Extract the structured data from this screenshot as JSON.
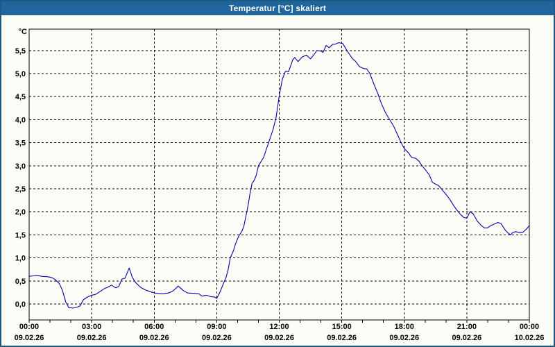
{
  "window": {
    "title": "Temperatur [°C] skaliert"
  },
  "colors": {
    "titlebar_bg": "#20659b",
    "title_text": "#ffffff",
    "window_border": "#1b5a82",
    "window_bg": "#fdfdf8",
    "grid": "#000000",
    "axis_text": "#000000",
    "series_line": "#0000a8"
  },
  "chart_data": {
    "type": "line",
    "title": "Temperatur [°C] skaliert",
    "xlabel": "",
    "ylabel": "°C",
    "xlim_hours": [
      0,
      24
    ],
    "ylim": [
      -0.35,
      5.97
    ],
    "grid": "dashed; horizontal every 0.5 °C, vertical every 3 h; minor x ticks every 1 h",
    "legend": "none",
    "y_ticks": [
      {
        "v": 0.0,
        "label": "0,0"
      },
      {
        "v": 0.5,
        "label": "0,5"
      },
      {
        "v": 1.0,
        "label": "1,0"
      },
      {
        "v": 1.5,
        "label": "1,5"
      },
      {
        "v": 2.0,
        "label": "2,0"
      },
      {
        "v": 2.5,
        "label": "2,5"
      },
      {
        "v": 3.0,
        "label": "3,0"
      },
      {
        "v": 3.5,
        "label": "3,5"
      },
      {
        "v": 4.0,
        "label": "4,0"
      },
      {
        "v": 4.5,
        "label": "4,5"
      },
      {
        "v": 5.0,
        "label": "5,0"
      },
      {
        "v": 5.5,
        "label": "5,5"
      }
    ],
    "x_ticks": [
      {
        "h": 0,
        "time": "00:00",
        "date": "09.02.26",
        "gridline": false
      },
      {
        "h": 3,
        "time": "03:00",
        "date": "09.02.26",
        "gridline": true
      },
      {
        "h": 6,
        "time": "06:00",
        "date": "09.02.26",
        "gridline": true
      },
      {
        "h": 9,
        "time": "09:00",
        "date": "09.02.26",
        "gridline": true
      },
      {
        "h": 12,
        "time": "12:00",
        "date": "09.02.26",
        "gridline": true
      },
      {
        "h": 15,
        "time": "15:00",
        "date": "09.02.26",
        "gridline": true
      },
      {
        "h": 18,
        "time": "18:00",
        "date": "09.02.26",
        "gridline": true
      },
      {
        "h": 21,
        "time": "21:00",
        "date": "09.02.26",
        "gridline": true
      },
      {
        "h": 24,
        "time": "00:00",
        "date": "10.02.26",
        "gridline": false
      }
    ],
    "minor_x_tick_every_hours": 1,
    "series": [
      {
        "name": "Temperatur",
        "color": "#0000a8",
        "points": [
          [
            0,
            0.6
          ],
          [
            0.2,
            0.61
          ],
          [
            0.4,
            0.62
          ],
          [
            0.6,
            0.6
          ],
          [
            0.9,
            0.59
          ],
          [
            1.1,
            0.57
          ],
          [
            1.25,
            0.53
          ],
          [
            1.45,
            0.44
          ],
          [
            1.6,
            0.29
          ],
          [
            1.75,
            0.05
          ],
          [
            1.9,
            -0.08
          ],
          [
            2.1,
            -0.09
          ],
          [
            2.3,
            -0.07
          ],
          [
            2.45,
            -0.04
          ],
          [
            2.6,
            0.09
          ],
          [
            2.8,
            0.15
          ],
          [
            3.0,
            0.19
          ],
          [
            3.2,
            0.21
          ],
          [
            3.4,
            0.27
          ],
          [
            3.6,
            0.33
          ],
          [
            3.8,
            0.37
          ],
          [
            3.95,
            0.41
          ],
          [
            4.15,
            0.35
          ],
          [
            4.3,
            0.38
          ],
          [
            4.45,
            0.54
          ],
          [
            4.6,
            0.56
          ],
          [
            4.8,
            0.78
          ],
          [
            4.95,
            0.58
          ],
          [
            5.1,
            0.47
          ],
          [
            5.35,
            0.36
          ],
          [
            5.6,
            0.3
          ],
          [
            5.85,
            0.26
          ],
          [
            6.1,
            0.23
          ],
          [
            6.4,
            0.22
          ],
          [
            6.7,
            0.24
          ],
          [
            6.9,
            0.28
          ],
          [
            7.15,
            0.39
          ],
          [
            7.4,
            0.29
          ],
          [
            7.6,
            0.24
          ],
          [
            7.9,
            0.23
          ],
          [
            8.15,
            0.22
          ],
          [
            8.3,
            0.17
          ],
          [
            8.5,
            0.19
          ],
          [
            8.7,
            0.16
          ],
          [
            8.9,
            0.15
          ],
          [
            9.0,
            0.12
          ],
          [
            9.15,
            0.25
          ],
          [
            9.3,
            0.42
          ],
          [
            9.45,
            0.58
          ],
          [
            9.55,
            0.75
          ],
          [
            9.65,
            1.0
          ],
          [
            9.8,
            1.15
          ],
          [
            9.9,
            1.3
          ],
          [
            10.05,
            1.47
          ],
          [
            10.2,
            1.57
          ],
          [
            10.3,
            1.68
          ],
          [
            10.4,
            1.9
          ],
          [
            10.5,
            2.12
          ],
          [
            10.6,
            2.4
          ],
          [
            10.7,
            2.62
          ],
          [
            10.8,
            2.68
          ],
          [
            10.9,
            2.8
          ],
          [
            11.0,
            3.0
          ],
          [
            11.25,
            3.18
          ],
          [
            11.45,
            3.45
          ],
          [
            11.7,
            3.78
          ],
          [
            11.85,
            4.05
          ],
          [
            12.0,
            4.52
          ],
          [
            12.15,
            4.88
          ],
          [
            12.3,
            5.05
          ],
          [
            12.45,
            5.04
          ],
          [
            12.65,
            5.3
          ],
          [
            12.75,
            5.35
          ],
          [
            12.9,
            5.26
          ],
          [
            13.1,
            5.36
          ],
          [
            13.3,
            5.4
          ],
          [
            13.5,
            5.32
          ],
          [
            13.65,
            5.4
          ],
          [
            13.8,
            5.5
          ],
          [
            14.0,
            5.49
          ],
          [
            14.1,
            5.46
          ],
          [
            14.25,
            5.61
          ],
          [
            14.4,
            5.56
          ],
          [
            14.55,
            5.63
          ],
          [
            14.7,
            5.64
          ],
          [
            14.85,
            5.67
          ],
          [
            15.05,
            5.65
          ],
          [
            15.25,
            5.5
          ],
          [
            15.5,
            5.33
          ],
          [
            15.65,
            5.27
          ],
          [
            15.85,
            5.15
          ],
          [
            16.05,
            5.11
          ],
          [
            16.2,
            5.1
          ],
          [
            16.35,
            5.0
          ],
          [
            16.5,
            4.82
          ],
          [
            16.7,
            4.6
          ],
          [
            16.9,
            4.35
          ],
          [
            17.1,
            4.15
          ],
          [
            17.3,
            4.0
          ],
          [
            17.5,
            3.85
          ],
          [
            17.7,
            3.65
          ],
          [
            17.85,
            3.5
          ],
          [
            18.0,
            3.37
          ],
          [
            18.2,
            3.28
          ],
          [
            18.35,
            3.18
          ],
          [
            18.55,
            3.16
          ],
          [
            18.7,
            3.1
          ],
          [
            18.85,
            3.0
          ],
          [
            19.0,
            2.92
          ],
          [
            19.2,
            2.8
          ],
          [
            19.35,
            2.64
          ],
          [
            19.5,
            2.6
          ],
          [
            19.65,
            2.57
          ],
          [
            19.85,
            2.46
          ],
          [
            20.0,
            2.38
          ],
          [
            20.2,
            2.26
          ],
          [
            20.35,
            2.15
          ],
          [
            20.5,
            2.05
          ],
          [
            20.7,
            1.94
          ],
          [
            20.85,
            1.88
          ],
          [
            21.0,
            1.86
          ],
          [
            21.15,
            2.0
          ],
          [
            21.3,
            1.96
          ],
          [
            21.5,
            1.8
          ],
          [
            21.7,
            1.7
          ],
          [
            21.85,
            1.65
          ],
          [
            22.0,
            1.65
          ],
          [
            22.15,
            1.7
          ],
          [
            22.35,
            1.74
          ],
          [
            22.5,
            1.77
          ],
          [
            22.65,
            1.74
          ],
          [
            22.85,
            1.6
          ],
          [
            23.0,
            1.53
          ],
          [
            23.1,
            1.5
          ],
          [
            23.2,
            1.55
          ],
          [
            23.35,
            1.57
          ],
          [
            23.55,
            1.55
          ],
          [
            23.7,
            1.56
          ],
          [
            23.85,
            1.62
          ],
          [
            24.0,
            1.7
          ]
        ]
      }
    ]
  }
}
